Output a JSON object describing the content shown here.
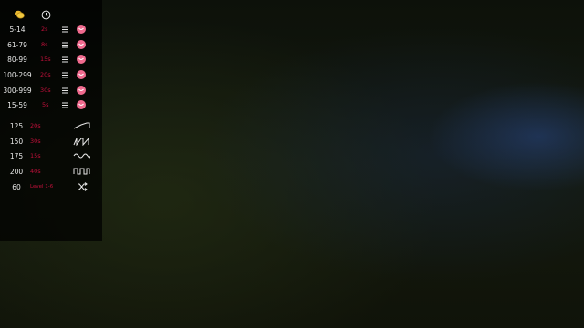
{
  "panel": {
    "header_icons": [
      "coins-icon",
      "clock-icon"
    ],
    "ranges": [
      {
        "label": "5-14",
        "value": "2s"
      },
      {
        "label": "61-79",
        "value": "8s"
      },
      {
        "label": "80-99",
        "value": "15s"
      },
      {
        "label": "100-299",
        "value": "20s"
      },
      {
        "label": "300-999",
        "value": "30s"
      },
      {
        "label": "15-59",
        "value": "5s"
      }
    ],
    "patterns": [
      {
        "label": "125",
        "value": "20s",
        "icon": "ramp-wave-icon"
      },
      {
        "label": "150",
        "value": "30s",
        "icon": "sawtooth-wave-icon"
      },
      {
        "label": "175",
        "value": "15s",
        "icon": "sine-wave-icon"
      },
      {
        "label": "200",
        "value": "40s",
        "icon": "square-wave-icon"
      },
      {
        "label": "60",
        "value": "Level 1-6",
        "icon": "shuffle-icon"
      }
    ]
  },
  "colors": {
    "value_text": "#c0103a",
    "face_icon": "#f06a8e",
    "coin": "#e8b830"
  }
}
